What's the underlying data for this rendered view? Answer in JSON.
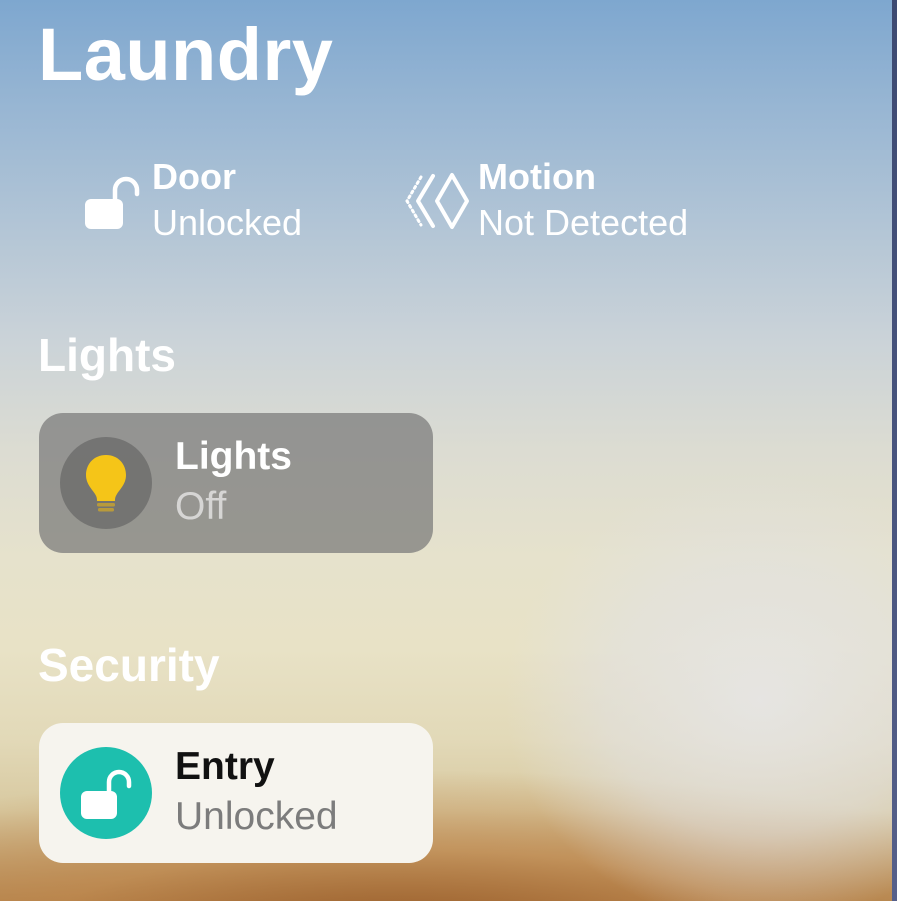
{
  "room": {
    "title": "Laundry"
  },
  "status": {
    "door": {
      "label": "Door",
      "value": "Unlocked",
      "icon": "unlocked-padlock-icon"
    },
    "motion": {
      "label": "Motion",
      "value": "Not Detected",
      "icon": "motion-sensor-icon"
    }
  },
  "sections": {
    "lights": {
      "heading": "Lights",
      "tiles": [
        {
          "name": "Lights",
          "state": "Off",
          "icon": "lightbulb-icon"
        }
      ]
    },
    "security": {
      "heading": "Security",
      "tiles": [
        {
          "name": "Entry",
          "state": "Unlocked",
          "icon": "unlocked-padlock-icon"
        }
      ]
    }
  },
  "colors": {
    "lock_accent": "#1dbfae",
    "bulb": "#f5c518",
    "tile_active_bg": "#f6f4ee",
    "tile_off_bg": "#787878"
  }
}
